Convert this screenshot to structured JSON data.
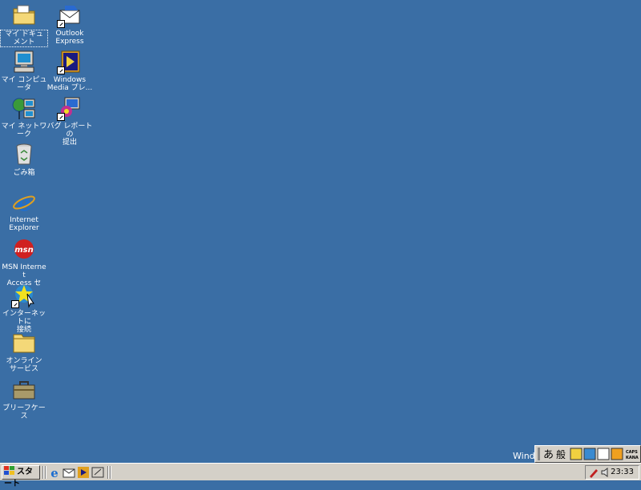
{
  "desktop": {
    "icons": [
      {
        "id": "my-documents",
        "label": "マイ ドキュメント"
      },
      {
        "id": "outlook-express",
        "label": "Outlook\nExpress"
      },
      {
        "id": "my-computer",
        "label": "マイ コンピュータ"
      },
      {
        "id": "windows-media",
        "label": "Windows\nMedia プレ..."
      },
      {
        "id": "my-network",
        "label": "マイ ネットワーク"
      },
      {
        "id": "bug-report",
        "label": "バグ レポートの\n提出"
      },
      {
        "id": "recycle-bin",
        "label": "ごみ箱"
      },
      {
        "id": "internet-explorer",
        "label": "Internet\nExplorer"
      },
      {
        "id": "msn",
        "label": "MSN Internet\nAccess セッ..."
      },
      {
        "id": "connect-internet",
        "label": "インターネットに\n接続"
      },
      {
        "id": "online-services",
        "label": "オンライン\nサービス"
      },
      {
        "id": "briefcase",
        "label": "ブリーフケース"
      }
    ],
    "msn_logo_text": "msn",
    "floating_text": "Windo"
  },
  "taskbar": {
    "start_label": "スタート",
    "clock": "23:33"
  },
  "langbar": {
    "mode_label": "あ",
    "ime_label": "般",
    "caps_label": "CAPS",
    "kana_label": "KANA"
  },
  "colors": {
    "desktop": "#3a6ea5",
    "taskbar": "#d4d0c8"
  }
}
